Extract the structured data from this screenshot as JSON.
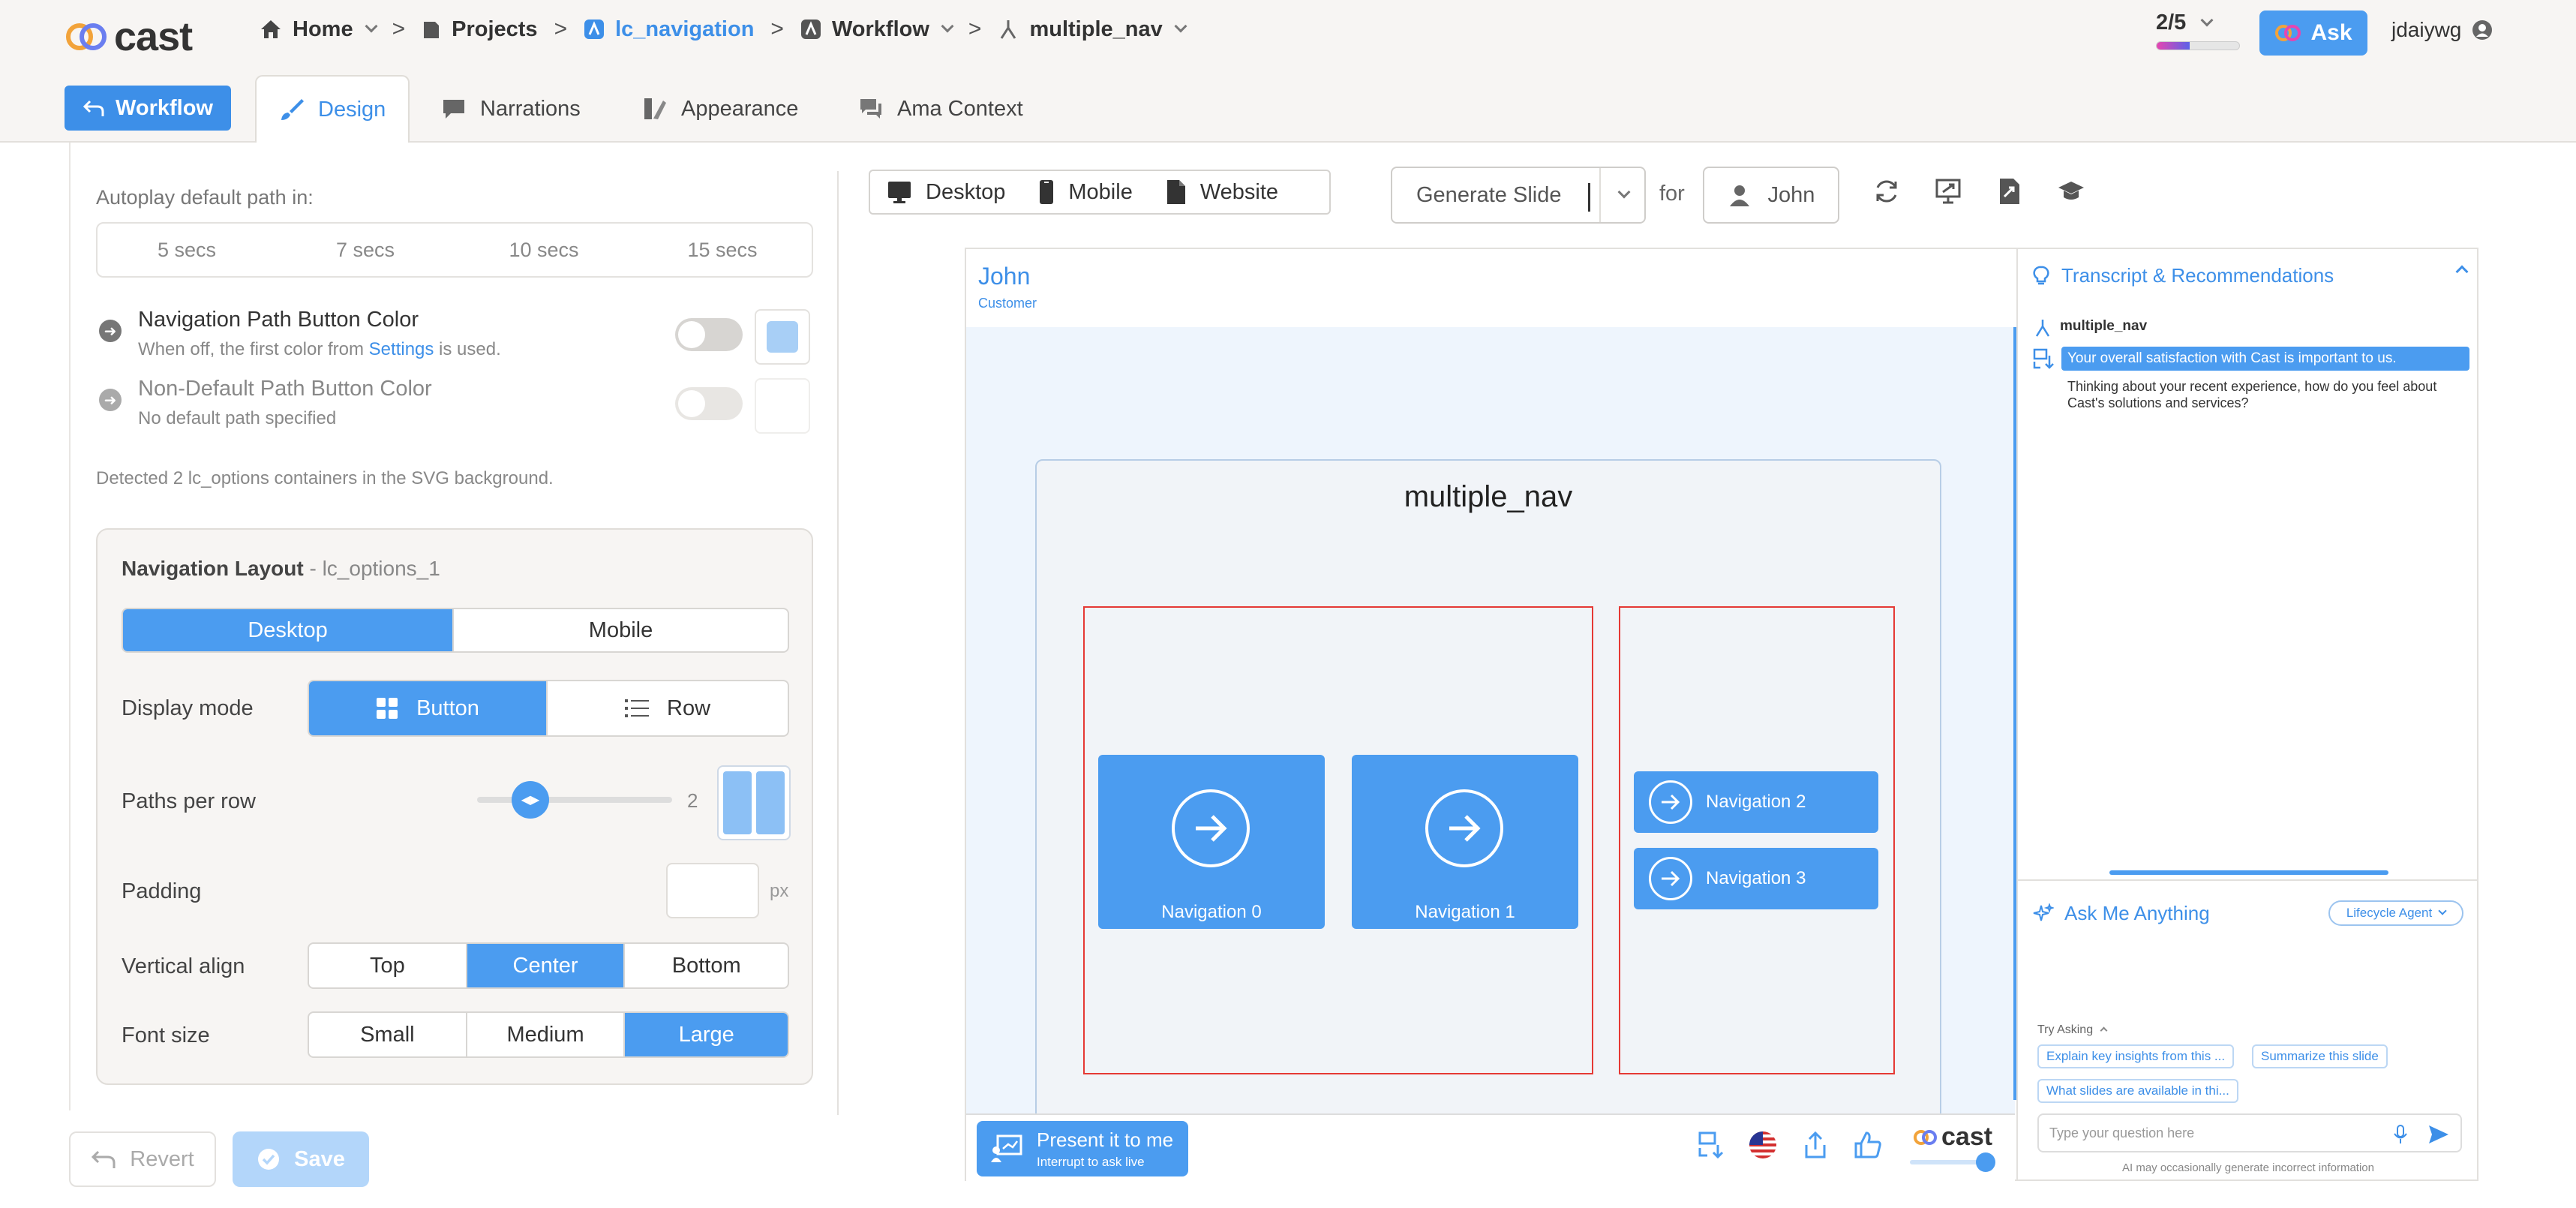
{
  "header": {
    "logo_text": "cast",
    "breadcrumbs": [
      {
        "label": "Home",
        "icon": "home-icon",
        "dropdown": true
      },
      {
        "label": "Projects",
        "icon": "folder-icon",
        "dropdown": false
      },
      {
        "label": "lc_navigation",
        "icon": "project-icon",
        "dropdown": false,
        "active": true
      },
      {
        "label": "Workflow",
        "icon": "workflow-icon",
        "dropdown": true
      },
      {
        "label": "multiple_nav",
        "icon": "branch-icon",
        "dropdown": true
      }
    ],
    "counter": "2/5",
    "counter_progress": 0.4,
    "ask_label": "Ask",
    "username": "jdaiywg"
  },
  "tabs": {
    "workflow_button": "Workflow",
    "items": [
      {
        "label": "Design",
        "active": true
      },
      {
        "label": "Narrations"
      },
      {
        "label": "Appearance"
      },
      {
        "label": "Ama Context"
      }
    ]
  },
  "left": {
    "autoplay_label": "Autoplay default path in:",
    "autoplay_options": [
      "5 secs",
      "7 secs",
      "10 secs",
      "15 secs"
    ],
    "nav_color": {
      "title": "Navigation Path Button Color",
      "sub_pre": "When off, the first color from ",
      "sub_link": "Settings",
      "sub_post": " is used.",
      "swatch": "#a8cff6"
    },
    "nondefault_color": {
      "title": "Non-Default Path Button Color",
      "sub": "No default path specified"
    },
    "detected": "Detected 2 lc_options containers in the SVG background.",
    "layout": {
      "title": "Navigation Layout",
      "container": "- lc_options_1",
      "device_options": [
        "Desktop",
        "Mobile"
      ],
      "display_mode_label": "Display mode",
      "display_options": [
        "Button",
        "Row"
      ],
      "paths_per_row_label": "Paths per row",
      "paths_per_row_value": "2",
      "padding_label": "Padding",
      "padding_unit": "px",
      "valign_label": "Vertical align",
      "valign_options": [
        "Top",
        "Center",
        "Bottom"
      ],
      "fontsize_label": "Font size",
      "fontsize_options": [
        "Small",
        "Medium",
        "Large"
      ]
    },
    "revert": "Revert",
    "save": "Save"
  },
  "toolbar": {
    "devices": [
      "Desktop",
      "Mobile",
      "Website"
    ],
    "generate": "Generate Slide",
    "for": "for",
    "person": "John"
  },
  "preview": {
    "viewer_name": "John",
    "viewer_role": "Customer",
    "slide_title": "multiple_nav",
    "nav_big": [
      "Navigation 0",
      "Navigation 1"
    ],
    "nav_small": [
      "Navigation 2",
      "Navigation 3"
    ],
    "present_title": "Present it to me",
    "present_sub": "Interrupt to ask live",
    "brand": "cast"
  },
  "transcript": {
    "header": "Transcript & Recommendations",
    "section": "multiple_nav",
    "highlight": "Your overall satisfaction with Cast is important to us.",
    "message": "Thinking about your recent experience, how do you feel about Cast's solutions and services?"
  },
  "ama": {
    "header": "Ask Me Anything",
    "agent": "Lifecycle Agent",
    "try_label": "Try Asking",
    "chips": [
      "Explain key insights from this ...",
      "Summarize this slide",
      "What slides are available in thi..."
    ],
    "placeholder": "Type your question here",
    "disclaimer": "AI may occasionally generate incorrect information"
  }
}
